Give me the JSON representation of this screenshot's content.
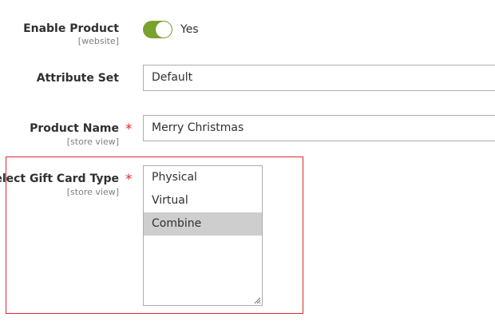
{
  "enable_product": {
    "label": "Enable Product",
    "scope": "[website]",
    "toggle_on": true,
    "toggle_text": "Yes",
    "toggle_color": "#79a22e"
  },
  "attribute_set": {
    "label": "Attribute Set",
    "value": "Default"
  },
  "product_name": {
    "label": "Product Name",
    "required_marker": "*",
    "scope": "[store view]",
    "value": "Merry Christmas"
  },
  "gift_card_type": {
    "label": "Select Gift Card Type",
    "required_marker": "*",
    "scope": "[store view]",
    "options": [
      {
        "label": "Physical",
        "selected": false
      },
      {
        "label": "Virtual",
        "selected": false
      },
      {
        "label": "Combine",
        "selected": true
      }
    ],
    "highlight_color": "#e0282e"
  }
}
